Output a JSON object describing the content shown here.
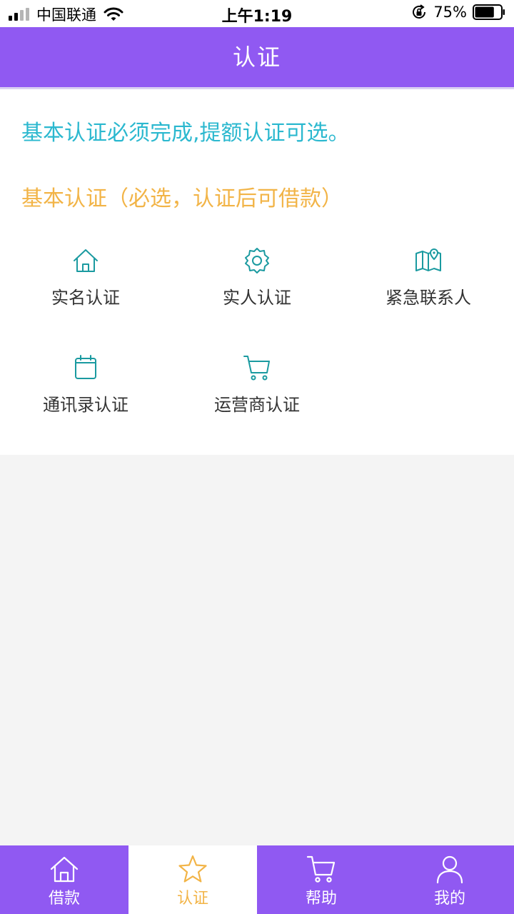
{
  "status_bar": {
    "carrier": "中国联通",
    "time": "上午1:19",
    "battery_percent": "75%",
    "battery_level": 0.75,
    "signal_bars_filled": 2,
    "signal_bars_total": 4
  },
  "nav": {
    "title": "认证"
  },
  "content": {
    "notice": "基本认证必须完成,提额认证可选。",
    "section_title": "基本认证（必选，认证后可借款）",
    "items": [
      {
        "label": "实名认证",
        "icon": "home-icon"
      },
      {
        "label": "实人认证",
        "icon": "gear-icon"
      },
      {
        "label": "紧急联系人",
        "icon": "map-pin-icon"
      },
      {
        "label": "通讯录认证",
        "icon": "calendar-icon"
      },
      {
        "label": "运营商认证",
        "icon": "cart-icon"
      }
    ]
  },
  "tabs": [
    {
      "label": "借款",
      "icon": "home-icon",
      "active": false
    },
    {
      "label": "认证",
      "icon": "star-icon",
      "active": true
    },
    {
      "label": "帮助",
      "icon": "cart-icon",
      "active": false
    },
    {
      "label": "我的",
      "icon": "user-icon",
      "active": false
    }
  ],
  "colors": {
    "primary": "#9059f2",
    "notice_text": "#2bb8cf",
    "section_text": "#f2b447",
    "icon_teal": "#1a9aa0",
    "active_tab_text": "#f2b447"
  }
}
